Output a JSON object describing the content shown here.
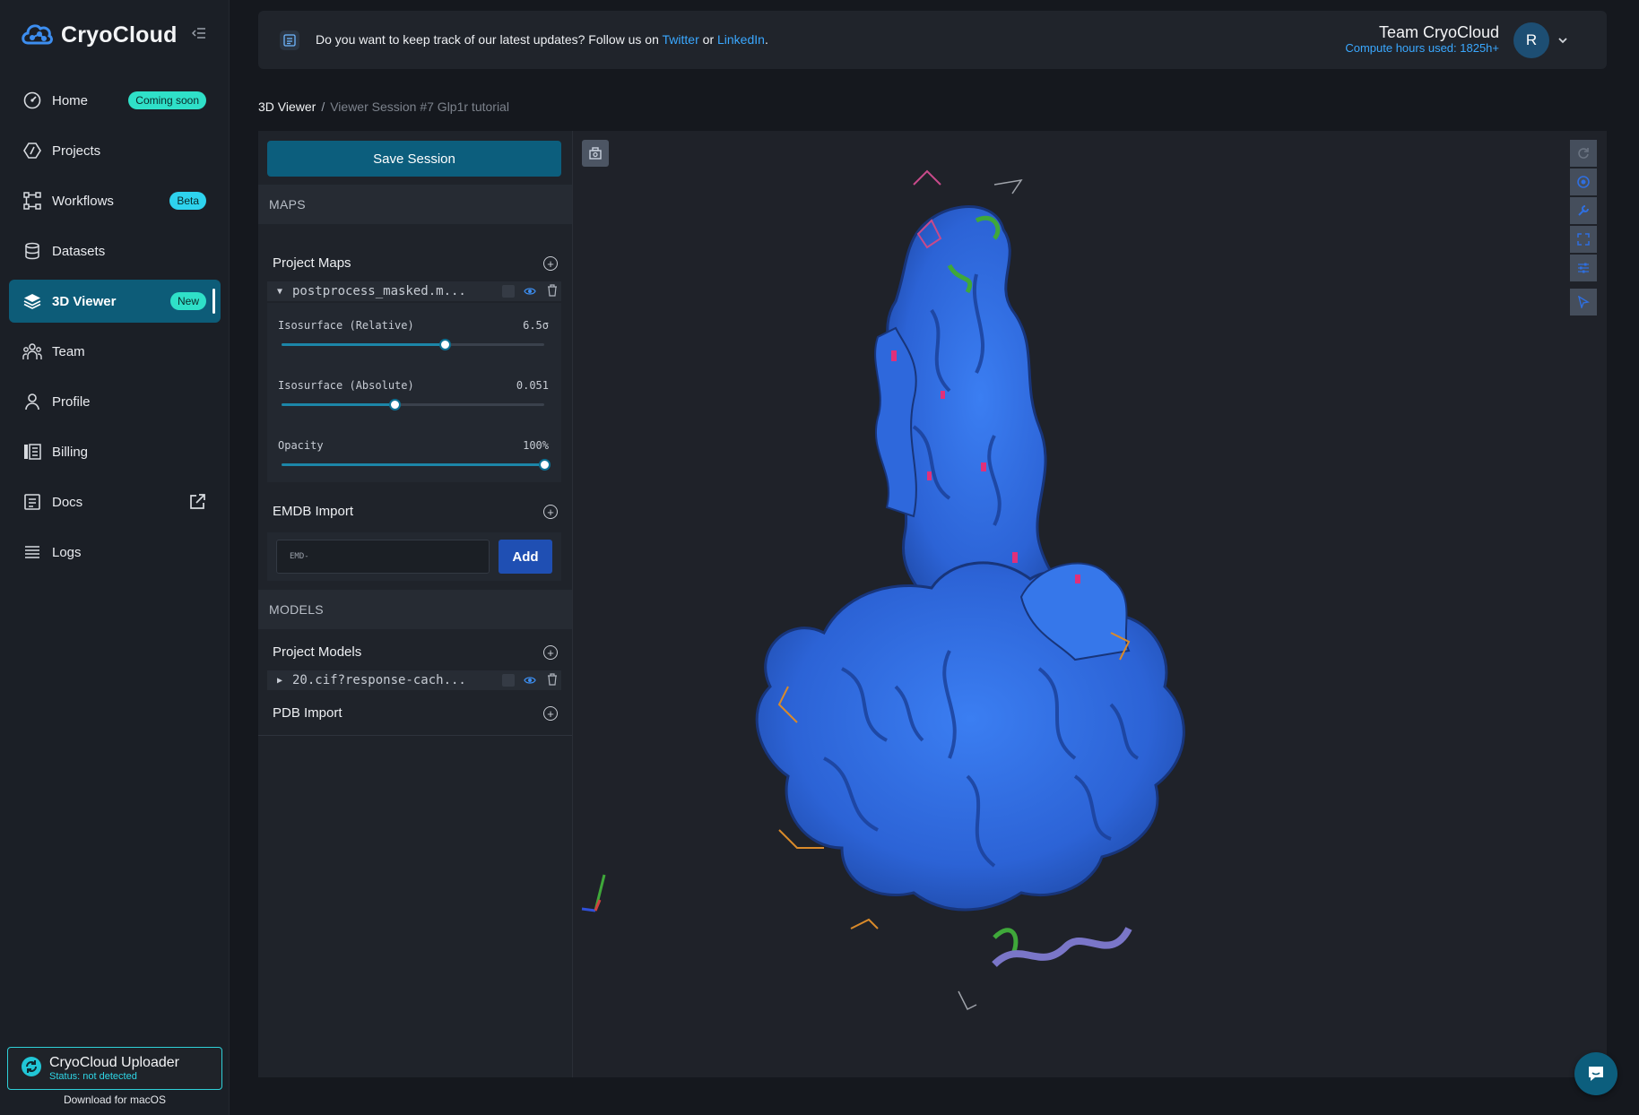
{
  "brand": {
    "name": "CryoCloud"
  },
  "sidebar": {
    "items": [
      {
        "label": "Home",
        "icon": "gauge-icon",
        "badge": "Coming soon"
      },
      {
        "label": "Projects",
        "icon": "projects-icon",
        "badge": ""
      },
      {
        "label": "Workflows",
        "icon": "workflow-icon",
        "badge": "Beta"
      },
      {
        "label": "Datasets",
        "icon": "database-icon",
        "badge": ""
      },
      {
        "label": "3D Viewer",
        "icon": "layers-icon",
        "badge": "New",
        "active": true
      },
      {
        "label": "Team",
        "icon": "team-icon",
        "badge": ""
      },
      {
        "label": "Profile",
        "icon": "user-icon",
        "badge": ""
      },
      {
        "label": "Billing",
        "icon": "billing-icon",
        "badge": ""
      },
      {
        "label": "Docs",
        "icon": "docs-icon",
        "badge": "",
        "external": true
      },
      {
        "label": "Logs",
        "icon": "list-icon",
        "badge": ""
      }
    ],
    "uploader": {
      "title": "CryoCloud Uploader",
      "status": "Status: not detected",
      "download": "Download for macOS"
    }
  },
  "topbar": {
    "announcement_prefix": "Do you want to keep track of our latest updates? Follow us on",
    "link1": "Twitter",
    "conj": "or",
    "link2": "LinkedIn",
    "suffix": ".",
    "team_name": "Team CryoCloud",
    "compute_hours": "Compute hours used: 1825h+",
    "avatar_initial": "R"
  },
  "breadcrumb": {
    "root": "3D Viewer",
    "separator": "/",
    "current": "Viewer Session #7 Glp1r tutorial"
  },
  "panel": {
    "save_label": "Save Session",
    "maps": {
      "section": "MAPS",
      "project_maps": "Project Maps",
      "file": "postprocess_masked.m...",
      "sliders": [
        {
          "label": "Isosurface (Relative)",
          "value": "6.5σ",
          "fraction": 0.62
        },
        {
          "label": "Isosurface (Absolute)",
          "value": "0.051",
          "fraction": 0.43
        },
        {
          "label": "Opacity",
          "value": "100%",
          "fraction": 1.0
        }
      ],
      "emdb_import": "EMDB Import",
      "emdb_placeholder": "EMD-",
      "add_label": "Add"
    },
    "models": {
      "section": "MODELS",
      "project_models": "Project Models",
      "file": "20.cif?response-cach...",
      "pdb_import": "PDB Import"
    }
  },
  "colors": {
    "accent": "#0c5e7d",
    "link": "#3aa8ff",
    "badge": "#2fe0c8",
    "density": "#2f6fe0"
  }
}
